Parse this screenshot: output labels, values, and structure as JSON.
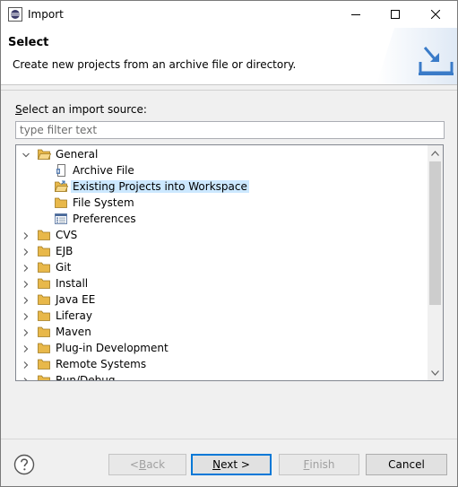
{
  "window": {
    "title": "Import"
  },
  "banner": {
    "title": "Select",
    "description": "Create new projects from an archive file or directory."
  },
  "source": {
    "label_prefix": "",
    "label_mnemonic": "S",
    "label_rest": "elect an import source:",
    "filter_placeholder": "type filter text"
  },
  "tree": {
    "items": [
      {
        "label": "General",
        "expanded": true,
        "level": 0,
        "icon": "folder-open-icon"
      },
      {
        "label": "Archive File",
        "level": 1,
        "icon": "archive-file-icon"
      },
      {
        "label": "Existing Projects into Workspace",
        "level": 1,
        "icon": "existing-projects-icon",
        "selected": true
      },
      {
        "label": "File System",
        "level": 1,
        "icon": "folder-icon"
      },
      {
        "label": "Preferences",
        "level": 1,
        "icon": "preferences-icon"
      },
      {
        "label": "CVS",
        "level": 0,
        "icon": "folder-icon"
      },
      {
        "label": "EJB",
        "level": 0,
        "icon": "folder-icon"
      },
      {
        "label": "Git",
        "level": 0,
        "icon": "folder-icon"
      },
      {
        "label": "Install",
        "level": 0,
        "icon": "folder-icon"
      },
      {
        "label": "Java EE",
        "level": 0,
        "icon": "folder-icon"
      },
      {
        "label": "Liferay",
        "level": 0,
        "icon": "folder-icon"
      },
      {
        "label": "Maven",
        "level": 0,
        "icon": "folder-icon"
      },
      {
        "label": "Plug-in Development",
        "level": 0,
        "icon": "folder-icon"
      },
      {
        "label": "Remote Systems",
        "level": 0,
        "icon": "folder-icon"
      },
      {
        "label": "Run/Debug",
        "level": 0,
        "icon": "folder-icon"
      }
    ]
  },
  "buttons": {
    "back": {
      "before": "< ",
      "mnemonic": "B",
      "after": "ack",
      "enabled": false
    },
    "next": {
      "before": "",
      "mnemonic": "N",
      "after": "ext >",
      "enabled": true
    },
    "finish": {
      "before": "",
      "mnemonic": "F",
      "after": "inish",
      "enabled": false
    },
    "cancel": {
      "label": "Cancel",
      "enabled": true
    }
  },
  "colors": {
    "selection": "#cce8ff",
    "accent": "#0078d7",
    "folder": "#e8b84a"
  }
}
